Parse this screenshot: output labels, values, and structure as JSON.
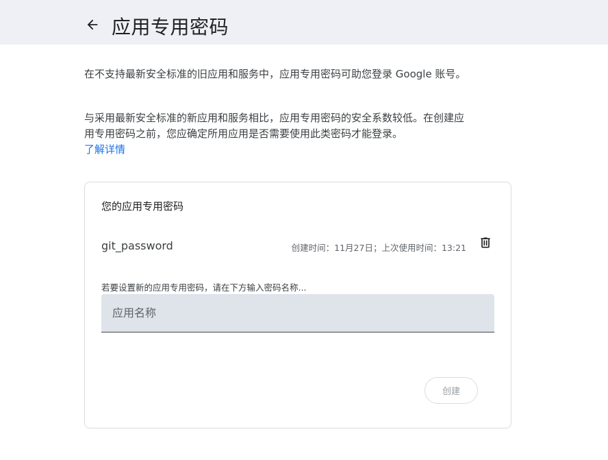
{
  "header": {
    "back_icon": "arrow-back-icon",
    "title": "应用专用密码"
  },
  "description": {
    "para1": "在不支持最新安全标准的旧应用和服务中，应用专用密码可助您登录 Google 账号。",
    "para2": "与采用最新安全标准的新应用和服务相比，应用专用密码的安全系数较低。在创建应用专用密码之前，您应确定所用应用是否需要使用此类密码才能登录。",
    "learn_more": "了解详情"
  },
  "card": {
    "title": "您的应用专用密码",
    "passwords": [
      {
        "name": "git_password",
        "meta": "创建时间：11月27日；上次使用时间：13:21",
        "delete_icon": "trash-icon"
      }
    ],
    "hint": "若要设置新的应用专用密码，请在下方输入密码名称...",
    "input": {
      "placeholder": "应用名称",
      "value": ""
    },
    "create_label": "创建"
  },
  "colors": {
    "header_bg": "#eef0f5",
    "link": "#1a73e8",
    "input_bg": "#dfe3ea"
  }
}
